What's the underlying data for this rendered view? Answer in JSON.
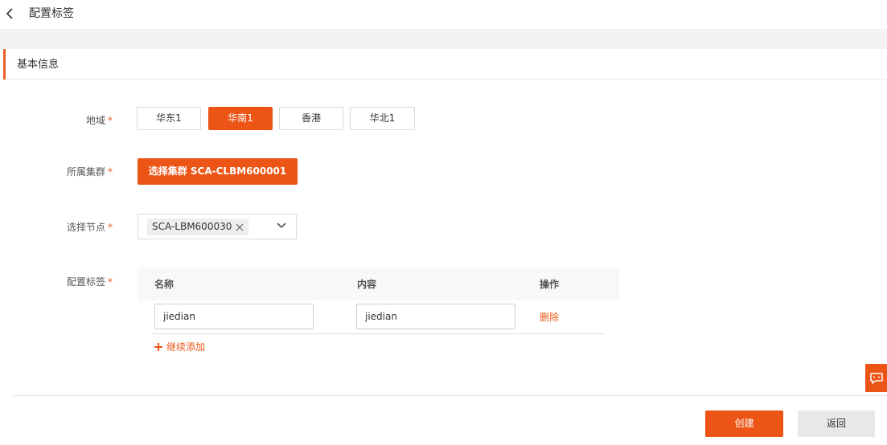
{
  "header": {
    "title": "配置标签"
  },
  "section": {
    "title": "基本信息"
  },
  "form": {
    "region": {
      "label": "地域",
      "required_mark": "*",
      "options": [
        "华东1",
        "华南1",
        "香港",
        "华北1"
      ],
      "selected": "华南1"
    },
    "cluster": {
      "label": "所属集群",
      "required_mark": "*",
      "button_label": "选择集群 SCA-CLBM600001"
    },
    "node": {
      "label": "选择节点",
      "required_mark": "*",
      "selected_tag": "SCA-LBM600030"
    },
    "tags": {
      "label": "配置标签",
      "required_mark": "*",
      "columns": {
        "name": "名称",
        "content": "内容",
        "action": "操作"
      },
      "rows": [
        {
          "name": "jiedian",
          "content": "jiedian",
          "action": "删除"
        }
      ],
      "add_label": "继续添加"
    }
  },
  "footer": {
    "create_label": "创建",
    "return_label": "返回"
  },
  "colors": {
    "accent": "#ec5516",
    "accent_bar": "#ec5e28"
  },
  "icons": {
    "back": "chevron-left-icon",
    "tag_close": "close-icon",
    "dropdown": "chevron-down-icon",
    "add": "plus-icon",
    "chat": "chat-icon"
  }
}
